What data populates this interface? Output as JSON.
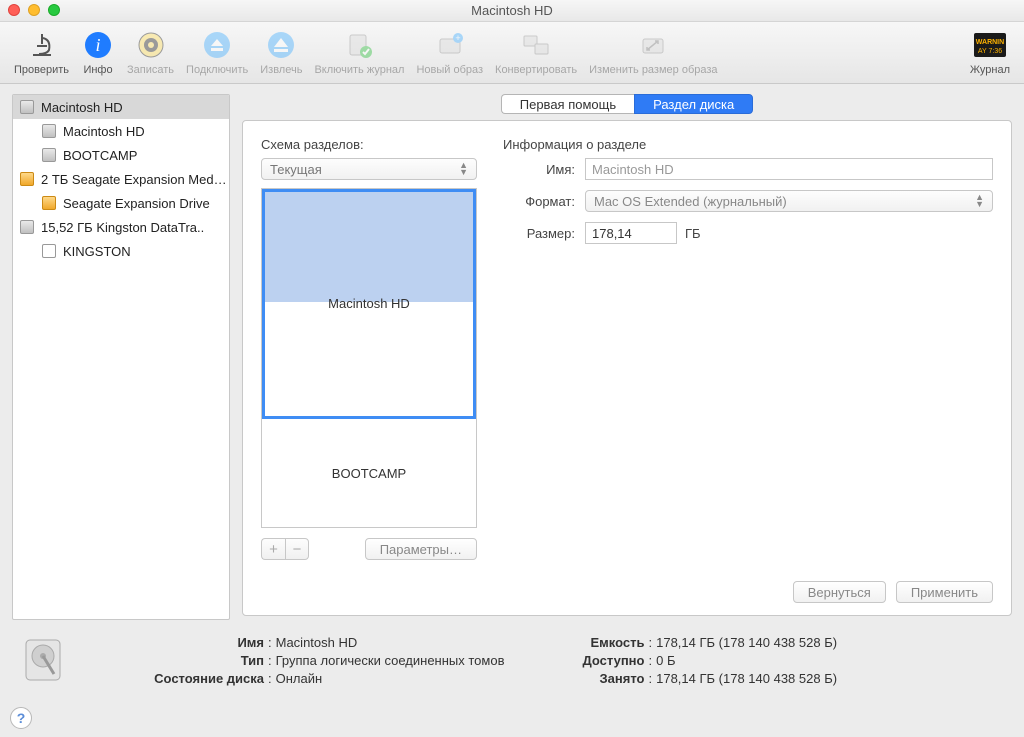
{
  "window": {
    "title": "Macintosh HD"
  },
  "toolbar": {
    "verify": {
      "label": "Проверить"
    },
    "info": {
      "label": "Инфо"
    },
    "burn": {
      "label": "Записать"
    },
    "mount": {
      "label": "Подключить"
    },
    "eject": {
      "label": "Извлечь"
    },
    "journal": {
      "label": "Включить журнал"
    },
    "newimage": {
      "label": "Новый образ"
    },
    "convert": {
      "label": "Конвертировать"
    },
    "resize": {
      "label": "Изменить размер образа"
    },
    "log": {
      "label": "Журнал"
    }
  },
  "sidebar": {
    "items": [
      {
        "label": "Macintosh HD",
        "kind": "hdd",
        "level": 0,
        "selected": true
      },
      {
        "label": "Macintosh HD",
        "kind": "hdd",
        "level": 1
      },
      {
        "label": "BOOTCAMP",
        "kind": "hdd",
        "level": 1
      },
      {
        "label": "2 ТБ Seagate Expansion Med…",
        "kind": "ext",
        "level": 0
      },
      {
        "label": "Seagate Expansion Drive",
        "kind": "ext",
        "level": 1
      },
      {
        "label": "15,52 ГБ Kingston DataTra..",
        "kind": "hdd",
        "level": 0
      },
      {
        "label": "KINGSTON",
        "kind": "usb",
        "level": 1
      }
    ]
  },
  "tabs": {
    "first_aid": "Первая помощь",
    "partition": "Раздел диска"
  },
  "left": {
    "header": "Схема разделов:",
    "layout_dropdown": "Текущая",
    "partitions": [
      {
        "label": "Macintosh HD",
        "height": 68,
        "selected": true
      },
      {
        "label": "BOOTCAMP",
        "height": 32,
        "selected": false
      }
    ],
    "options_btn": "Параметры…"
  },
  "right": {
    "header": "Информация о разделе",
    "name_label": "Имя:",
    "name_value": "Macintosh HD",
    "format_label": "Формат:",
    "format_value": "Mac OS Extended (журнальный)",
    "size_label": "Размер:",
    "size_value": "178,14",
    "size_unit": "ГБ",
    "revert_btn": "Вернуться",
    "apply_btn": "Применить"
  },
  "bottom": {
    "left": {
      "name_k": "Имя",
      "name_v": "Macintosh HD",
      "type_k": "Тип",
      "type_v": "Группа логически соединенных томов",
      "state_k": "Состояние диска",
      "state_v": "Онлайн"
    },
    "right": {
      "cap_k": "Емкость",
      "cap_v": "178,14 ГБ (178 140 438 528 Б)",
      "avail_k": "Доступно",
      "avail_v": "0 Б",
      "used_k": "Занято",
      "used_v": "178,14 ГБ (178 140 438 528 Б)"
    }
  }
}
